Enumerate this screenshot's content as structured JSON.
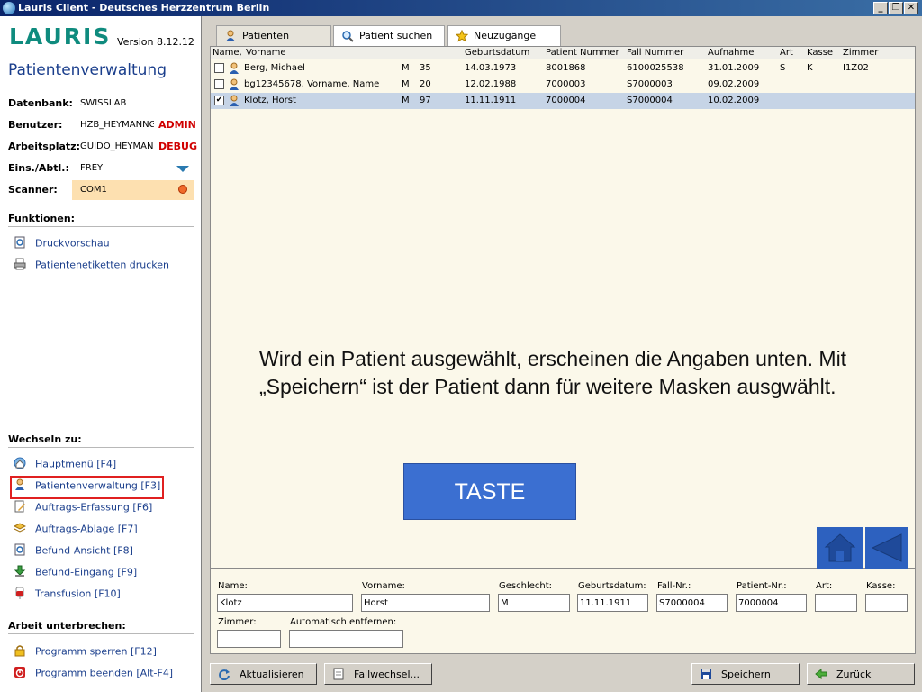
{
  "window": {
    "title": "Lauris Client - Deutsches Herzzentrum Berlin",
    "minimize": "_",
    "restore": "❐",
    "close": "✕"
  },
  "sidebar": {
    "logo": "LAURIS",
    "version": "Version 8.12.12",
    "app_title": "Patientenverwaltung",
    "info": {
      "datenbank_label": "Datenbank:",
      "datenbank_value": "SWISSLAB",
      "benutzer_label": "Benutzer:",
      "benutzer_value": "HZB_HEYMANNG",
      "benutzer_flag": "ADMIN",
      "arbeitsplatz_label": "Arbeitsplatz:",
      "arbeitsplatz_value": "GUIDO_HEYMAN",
      "arbeitsplatz_flag": "DEBUG",
      "einsabtl_label": "Eins./Abtl.:",
      "einsabtl_value": "FREY",
      "scanner_label": "Scanner:",
      "scanner_value": "COM1"
    },
    "funktionen_title": "Funktionen:",
    "funktionen": [
      {
        "label": "Druckvorschau",
        "icon": "print-preview-icon"
      },
      {
        "label": "Patientenetiketten drucken",
        "icon": "printer-icon"
      }
    ],
    "wechseln_title": "Wechseln zu:",
    "wechseln": [
      {
        "label": "Hauptmenü [F4]",
        "icon": "home-globe-icon"
      },
      {
        "label": "Patientenverwaltung [F3]",
        "icon": "patient-icon"
      },
      {
        "label": "Auftrags-Erfassung [F6]",
        "icon": "edit-order-icon"
      },
      {
        "label": "Auftrags-Ablage [F7]",
        "icon": "order-archive-icon"
      },
      {
        "label": "Befund-Ansicht [F8]",
        "icon": "result-view-icon"
      },
      {
        "label": "Befund-Eingang [F9]",
        "icon": "result-inbox-icon"
      },
      {
        "label": "Transfusion [F10]",
        "icon": "transfusion-icon"
      }
    ],
    "arbeit_title": "Arbeit unterbrechen:",
    "arbeit": [
      {
        "label": "Programm sperren [F12]",
        "icon": "lock-icon"
      },
      {
        "label": "Programm beenden [Alt-F4]",
        "icon": "power-icon"
      }
    ]
  },
  "tabs": [
    {
      "label": "Patienten",
      "icon": "patient-icon"
    },
    {
      "label": "Patient suchen",
      "icon": "search-icon"
    },
    {
      "label": "Neuzugänge",
      "icon": "star-icon"
    }
  ],
  "table": {
    "headers": [
      "Name,",
      "Vorname",
      "Geburtsdatum",
      "Patient Nummer",
      "Fall Nummer",
      "Aufnahme",
      "Art",
      "Kasse",
      "Zimmer"
    ],
    "rows": [
      {
        "checked": false,
        "name": "Berg,  Michael",
        "sex": "M",
        "age": "35",
        "dob": "14.03.1973",
        "patnr": "8001868",
        "fallnr": "6100025538",
        "aufnahme": "31.01.2009",
        "art": "S",
        "kasse": "K",
        "zimmer": "I1Z02"
      },
      {
        "checked": false,
        "name": "bg12345678,  Vorname, Name",
        "sex": "M",
        "age": "20",
        "dob": "12.02.1988",
        "patnr": "7000003",
        "fallnr": "S7000003",
        "aufnahme": "09.02.2009",
        "art": "",
        "kasse": "",
        "zimmer": ""
      },
      {
        "checked": true,
        "name": "Klotz,  Horst",
        "sex": "M",
        "age": "97",
        "dob": "11.11.1911",
        "patnr": "7000004",
        "fallnr": "S7000004",
        "aufnahme": "10.02.2009",
        "art": "",
        "kasse": "",
        "zimmer": ""
      }
    ]
  },
  "overlay": {
    "text": "Wird ein Patient ausgewählt, erscheinen die Angaben unten. Mit „Speichern“ ist der Patient dann für weitere Masken ausgwählt.",
    "button": "TASTE"
  },
  "details": {
    "name_label": "Name:",
    "name_value": "Klotz",
    "vorname_label": "Vorname:",
    "vorname_value": "Horst",
    "geschlecht_label": "Geschlecht:",
    "geschlecht_value": "M",
    "geburtsdatum_label": "Geburtsdatum:",
    "geburtsdatum_value": "11.11.1911",
    "fallnr_label": "Fall-Nr.:",
    "fallnr_value": "S7000004",
    "patientnr_label": "Patient-Nr.:",
    "patientnr_value": "7000004",
    "art_label": "Art:",
    "art_value": "",
    "kasse_label": "Kasse:",
    "kasse_value": "",
    "zimmer_label": "Zimmer:",
    "zimmer_value": "",
    "auto_label": "Automatisch entfernen:",
    "auto_value": ""
  },
  "buttons": {
    "aktualisieren": "Aktualisieren",
    "fallwechsel": "Fallwechsel...",
    "speichern": "Speichern",
    "zurueck": "Zurück"
  },
  "colors": {
    "accent_blue": "#3b6fd1",
    "alert_red": "#d00000",
    "scanner_bg": "#fde0b0",
    "selected_row": "#c6d4e6"
  }
}
